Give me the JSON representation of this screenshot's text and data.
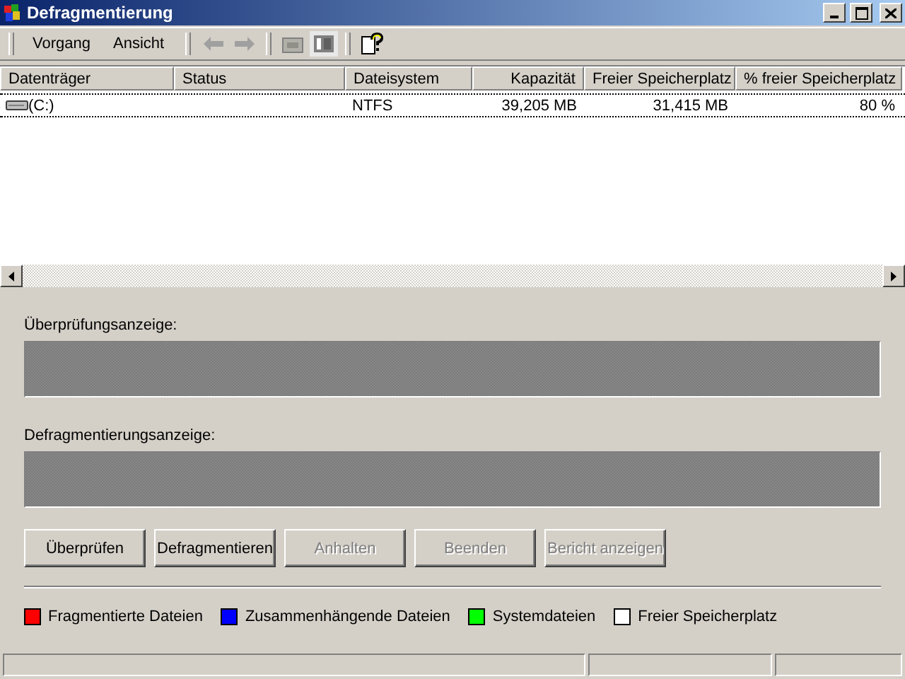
{
  "window": {
    "title": "Defragmentierung"
  },
  "menu": [
    "Vorgang",
    "Ansicht"
  ],
  "table": {
    "columns": [
      "Datenträger",
      "Status",
      "Dateisystem",
      "Kapazität",
      "Freier Speicherplatz",
      "% freier Speicherplatz"
    ],
    "rows": [
      {
        "volume": "(C:)",
        "filesystem": "NTFS",
        "capacity": "39,205 MB",
        "free": "31,415 MB",
        "free_percent": "80 %",
        "focused": true
      }
    ]
  },
  "analysis_display": {
    "label": "Überprüfungsanzeige:"
  },
  "defrag_display": {
    "label": "Defragmentierungsanzeige:"
  },
  "buttons": [
    {
      "label": "Überprüfen",
      "disabled": false
    },
    {
      "label": "Defragmentieren",
      "disabled": false
    },
    {
      "label": "Anhalten",
      "disabled": true
    },
    {
      "label": "Beenden",
      "disabled": true
    },
    {
      "label": "Bericht anzeigen",
      "disabled": true
    }
  ],
  "legend": [
    {
      "label": "Fragmentierte Dateien",
      "color": "#ff0000"
    },
    {
      "label": "Zusammenhängende Dateien",
      "color": "#0000ff"
    },
    {
      "label": "Systemdateien",
      "color": "#00ff00"
    },
    {
      "label": "Freier Speicherplatz",
      "color": "#ffffff"
    }
  ]
}
